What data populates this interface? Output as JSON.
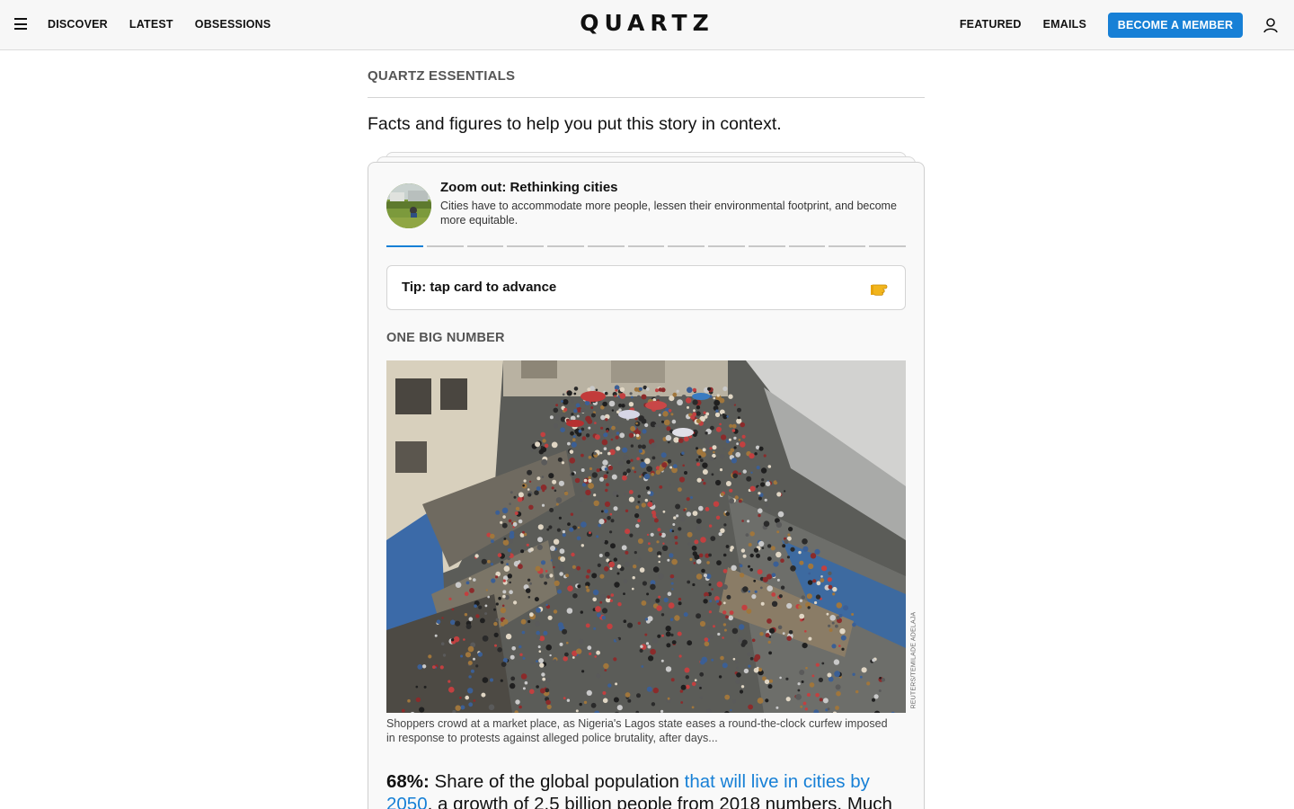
{
  "header": {
    "nav_left": [
      "DISCOVER",
      "LATEST",
      "OBSESSIONS"
    ],
    "logo": "QUARTZ",
    "nav_right": [
      "FEATURED",
      "EMAILS"
    ],
    "member_button": "BECOME A MEMBER",
    "icons": {
      "menu": "hamburger-menu-icon",
      "account": "user-account-icon"
    }
  },
  "essentials": {
    "section_label": "QUARTZ ESSENTIALS",
    "subheading": "Facts and figures to help you put this story in context.",
    "card": {
      "title": "Zoom out: Rethinking cities",
      "description": "Cities have to accommodate more people, lessen their environmental footprint, and become more equitable.",
      "progress_total": 13,
      "progress_current": 1,
      "tip": "Tip: tap card to advance",
      "tip_icon": "pointing-hand-icon",
      "section": "ONE BIG NUMBER",
      "photo_credit": "REUTERS/TEMILADE ADELAJA",
      "caption": "Shoppers crowd at a market place, as Nigeria's Lagos state eases a round-the-clock curfew imposed in response to protests against alleged police brutality, after days...",
      "stat": {
        "number": "68%:",
        "text_before": " Share of the global population ",
        "link": "that will live in cities by 2050",
        "text_after": ", a growth of 2.5 billion people from 2018 numbers. Much"
      }
    }
  },
  "colors": {
    "accent": "#1780d6",
    "header_bg": "#f7f7f7",
    "card_bg": "#f9f9f9"
  }
}
